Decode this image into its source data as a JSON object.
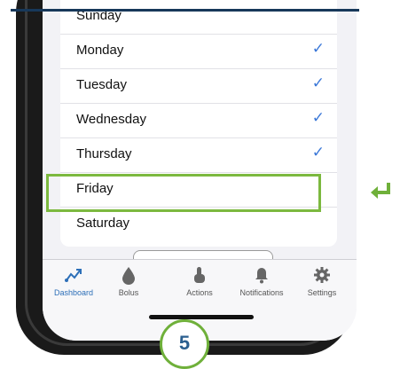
{
  "days": [
    {
      "label": "Sunday",
      "checked": false
    },
    {
      "label": "Monday",
      "checked": true
    },
    {
      "label": "Tuesday",
      "checked": true
    },
    {
      "label": "Wednesday",
      "checked": true
    },
    {
      "label": "Thursday",
      "checked": true
    },
    {
      "label": "Friday",
      "checked": false
    },
    {
      "label": "Saturday",
      "checked": false
    }
  ],
  "check_symbol": "✓",
  "tabs": [
    {
      "label": "Dashboard",
      "icon": "trend-arrow-icon",
      "active": true
    },
    {
      "label": "Bolus",
      "icon": "drop-icon",
      "active": false
    },
    {
      "label": "Actions",
      "icon": "tap-hand-icon",
      "active": false
    },
    {
      "label": "Notifications",
      "icon": "bell-icon",
      "active": false
    },
    {
      "label": "Settings",
      "icon": "gear-icon",
      "active": false
    }
  ],
  "step_number": "5",
  "colors": {
    "highlight": "#7cb93f",
    "check": "#3b78d8",
    "active_tab": "#2d6fb8",
    "step_text": "#2b5f8f"
  }
}
